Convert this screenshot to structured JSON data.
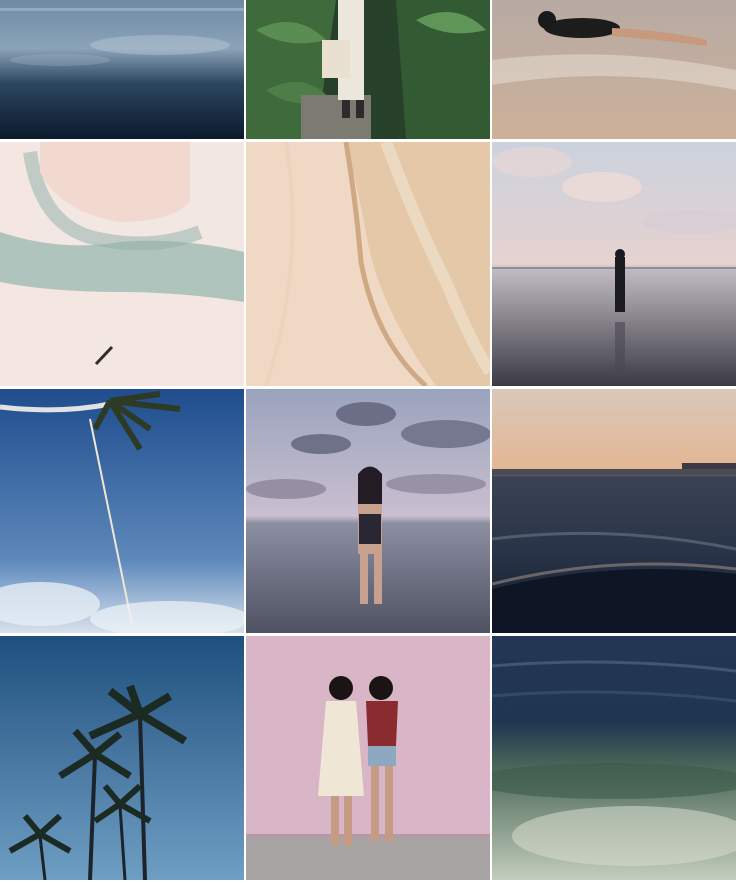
{
  "grid": {
    "columns": 3,
    "rows": 4,
    "tiles": [
      {
        "subject": "calm-water-reflection-photo",
        "palette": [
          "#0f2236",
          "#8fa9bd"
        ]
      },
      {
        "subject": "person-with-tote-bag-among-plants-photo",
        "palette": [
          "#2f4a2c",
          "#e8e2d8"
        ]
      },
      {
        "subject": "person-lying-in-shallow-surf-photo",
        "palette": [
          "#c7b3a4",
          "#1b1b1b"
        ]
      },
      {
        "subject": "aerial-sandbar-turquoise-water-photo",
        "palette": [
          "#efe3dd",
          "#8fb1ac"
        ]
      },
      {
        "subject": "sand-and-wave-edge-closeup-photo",
        "palette": [
          "#f0dcc7",
          "#d8c2a4"
        ]
      },
      {
        "subject": "person-wading-at-sunset-photo",
        "palette": [
          "#c7c7d4",
          "#2a2a34"
        ]
      },
      {
        "subject": "palm-and-rope-swing-blue-sky-photo",
        "palette": [
          "#2b5d9f",
          "#dfe8f2"
        ]
      },
      {
        "subject": "person-in-swimsuit-in-water-clouds-photo",
        "palette": [
          "#9aa0b9",
          "#2a2330"
        ]
      },
      {
        "subject": "sunset-over-ocean-waves-photo",
        "palette": [
          "#e0b493",
          "#1a2234"
        ]
      },
      {
        "subject": "palm-trees-against-blue-sky-photo",
        "palette": [
          "#245a8a",
          "#101820"
        ]
      },
      {
        "subject": "two-women-against-pink-wall-photo",
        "palette": [
          "#d9b3c6",
          "#2a1a1a"
        ]
      },
      {
        "subject": "clear-shallow-sea-over-sand-photo",
        "palette": [
          "#20344f",
          "#b9c7b6"
        ]
      }
    ]
  }
}
